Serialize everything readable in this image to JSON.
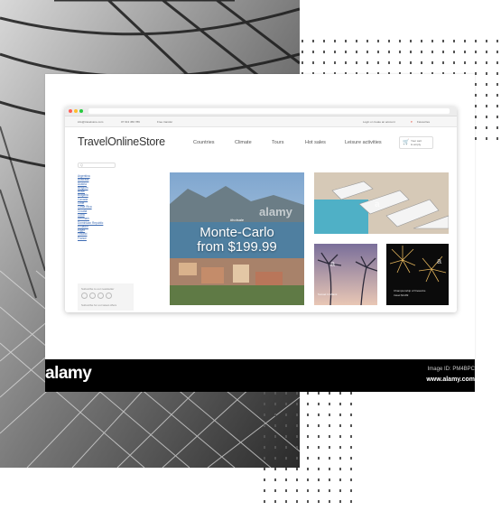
{
  "browser": {
    "topbar": {
      "email": "info@travelstore.com",
      "phone": "07 913 456 789",
      "delivery": "Free transfer",
      "login": "Login or create an account",
      "favourites": "Favourites"
    },
    "logo": "TravelOnlineStore",
    "nav": [
      "Countries",
      "Climate",
      "Tours",
      "Hot sales",
      "Leisure activities"
    ],
    "cart": {
      "line1": "Your cart",
      "line2": "is empty"
    },
    "search_placeholder": "Q",
    "countries": [
      "Argentina",
      "Australia",
      "Austria",
      "Belgium",
      "Brazil",
      "Bulgaria",
      "Canada",
      "Chile",
      "Costa Rica",
      "Croatia",
      "Cuba",
      "Denmark",
      "Dominican Republic",
      "Ecuador",
      "Egypt",
      "Finland",
      "France"
    ],
    "subscribe": {
      "title": "Subscribe to our newsletter",
      "note": "Subscribe for our latest offers"
    },
    "hero": {
      "tag": "#hotsale",
      "title": "Monte-Carlo",
      "price": "from $199.99"
    },
    "tile_palms": {
      "label": "Sunset in Miami"
    },
    "tile_fireworks": {
      "line1": "Championship of fireworks",
      "line2": "travel $1199"
    }
  },
  "watermarks": {
    "hero": "alamy",
    "pool": "a",
    "palms": "a",
    "fireworks": "a"
  },
  "banner": {
    "logo": "alamy",
    "image_id": "Image ID: PM4BPC",
    "site": "www.alamy.com"
  },
  "colors": {
    "accent_red": "#e74c3c",
    "link_blue": "#3d6bb3",
    "banner_black": "#000000"
  }
}
